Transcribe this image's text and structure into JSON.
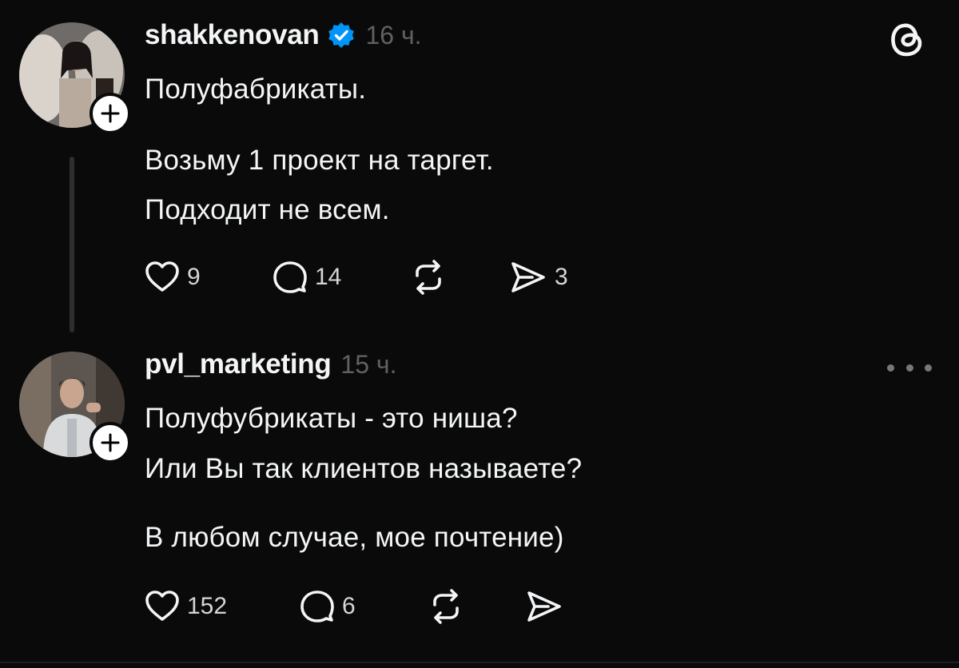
{
  "posts": [
    {
      "username": "shakkenovan",
      "verified": true,
      "time": "16 ч.",
      "lines": [
        "Полуфабрикаты.",
        "Возьму 1 проект на таргет.",
        "Подходит не всем."
      ],
      "likes": "9",
      "comments": "14",
      "shares": "3"
    },
    {
      "username": "pvl_marketing",
      "verified": false,
      "time": "15 ч.",
      "lines": [
        "Полуфубрикаты - это ниша?",
        "Или Вы так клиентов называете?",
        "В любом случае, мое почтение)"
      ],
      "likes": "152",
      "comments": "6"
    }
  ],
  "colors": {
    "background": "#0a0a0a",
    "text": "#f3f5f7",
    "muted": "#616161",
    "verified": "#0095f6",
    "thread_line": "#2e2e2e"
  },
  "icons": {
    "logo": "threads-logo-icon",
    "verified": "verified-badge-icon",
    "follow": "plus-icon",
    "like": "heart-icon",
    "comment": "comment-bubble-icon",
    "repost": "repost-icon",
    "share": "send-icon",
    "more": "more-dots-icon"
  }
}
